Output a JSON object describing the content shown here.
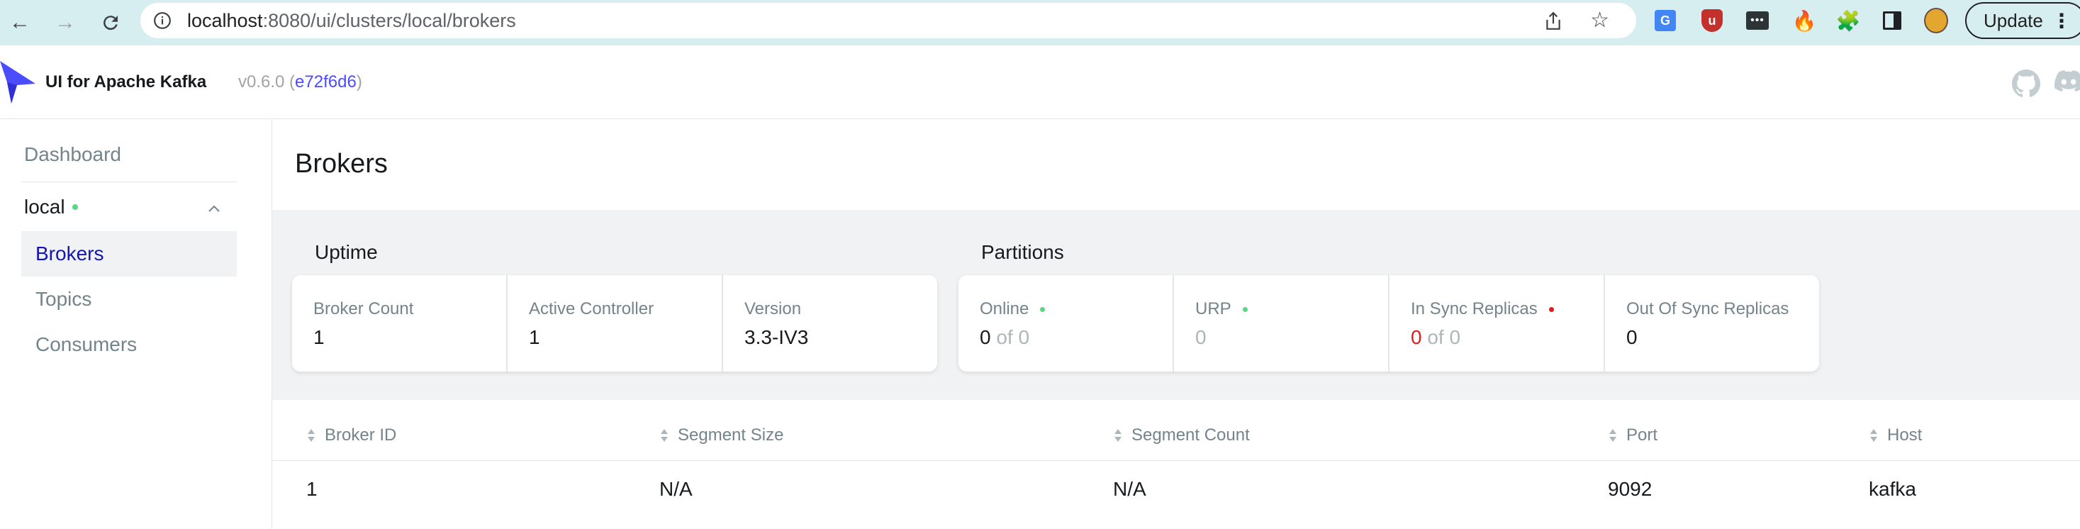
{
  "browser": {
    "url_host": "localhost",
    "url_rest": ":8080/ui/clusters/local/brokers",
    "update_label": "Update",
    "translate_ext_label": "G",
    "ublock_ext_label": "u",
    "dots_ext_label": "•••"
  },
  "header": {
    "app_title": "UI for Apache Kafka",
    "version_prefix": "v0.6.0 (",
    "commit": "e72f6d6",
    "version_suffix": ")"
  },
  "sidebar": {
    "dashboard": "Dashboard",
    "cluster_name": "local",
    "cluster_status_color": "#5cd685",
    "items": [
      {
        "label": "Brokers",
        "active": true
      },
      {
        "label": "Topics",
        "active": false
      },
      {
        "label": "Consumers",
        "active": false
      }
    ]
  },
  "page": {
    "title": "Brokers"
  },
  "uptime": {
    "title": "Uptime",
    "cards": [
      {
        "label": "Broker Count",
        "value": "1"
      },
      {
        "label": "Active Controller",
        "value": "1"
      },
      {
        "label": "Version",
        "value": "3.3-IV3"
      }
    ]
  },
  "partitions": {
    "title": "Partitions",
    "online": {
      "label": "Online",
      "value": "0",
      "suffix": " of 0",
      "status": "green"
    },
    "urp": {
      "label": "URP",
      "value": "0",
      "status": "green"
    },
    "in_sync": {
      "label": "In Sync Replicas",
      "value": "0",
      "suffix": " of 0",
      "status": "red"
    },
    "out_of_sync": {
      "label": "Out Of Sync Replicas",
      "value": "0"
    }
  },
  "table": {
    "headers": {
      "broker_id": "Broker ID",
      "segment_size": "Segment Size",
      "segment_count": "Segment Count",
      "port": "Port",
      "host": "Host"
    },
    "rows": [
      {
        "broker_id": "1",
        "segment_size": "N/A",
        "segment_count": "N/A",
        "port": "9092",
        "host": "kafka"
      }
    ]
  },
  "colors": {
    "accent": "#1414b8",
    "status_green": "#5cd685",
    "status_red": "#e51a1a",
    "chrome_bg": "#d7eef1"
  }
}
